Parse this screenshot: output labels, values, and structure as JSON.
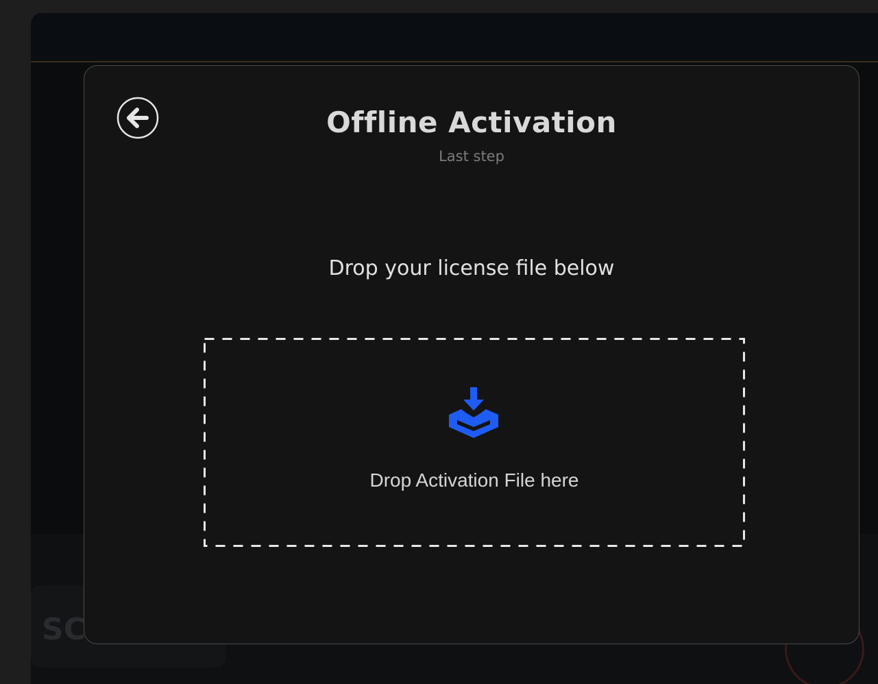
{
  "dialog": {
    "title": "Offline Activation",
    "subtitle": "Last step",
    "instruction": "Drop your license file below",
    "back_icon": "arrow-left-circle-icon"
  },
  "dropzone": {
    "label": "Drop Activation File here",
    "icon": "tray-download-icon",
    "icon_color": "#1e5cf5"
  },
  "background": {
    "faded_text": "SC"
  }
}
